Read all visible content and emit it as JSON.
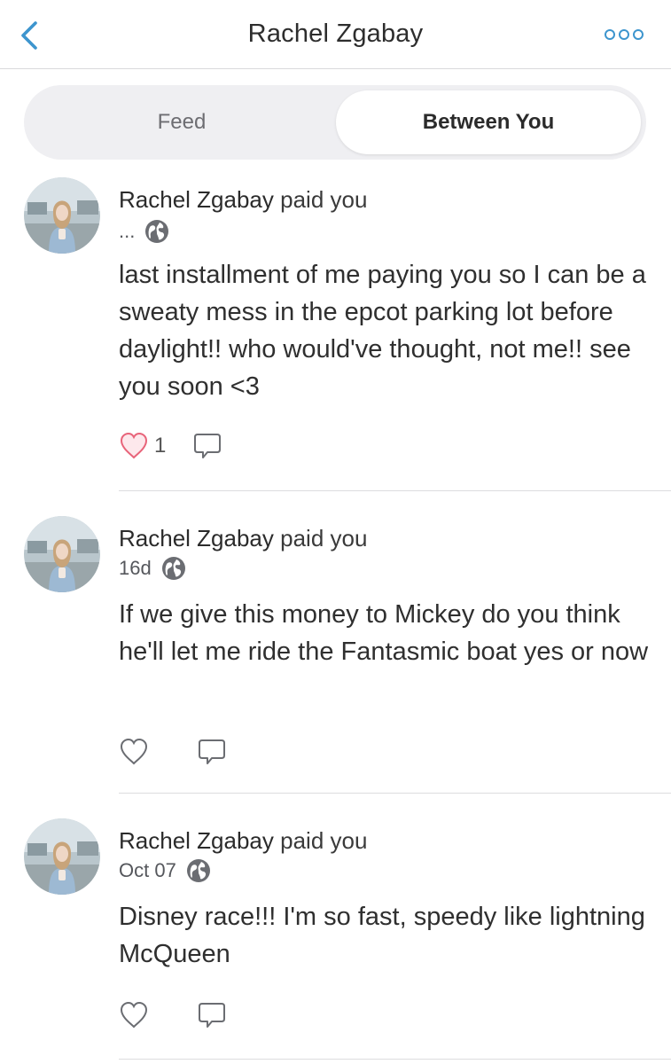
{
  "header": {
    "title": "Rachel Zgabay"
  },
  "tabs": [
    {
      "label": "Feed",
      "selected": false
    },
    {
      "label": "Between You",
      "selected": true
    }
  ],
  "stories": [
    {
      "name": "Rachel Zgabay",
      "action": "paid you",
      "time": "...",
      "note": "last installment of me paying you so I can be a sweaty mess in the epcot parking lot before daylight!! who would've thought, not me!! see you soon <3",
      "liked": true,
      "like_count": "1"
    },
    {
      "name": "Rachel Zgabay",
      "action": "paid you",
      "time": "16d",
      "note": "If we give this money to Mickey do you think he'll let me ride the Fantasmic boat yes or now",
      "liked": false,
      "like_count": ""
    },
    {
      "name": "Rachel Zgabay",
      "action": "paid you",
      "time": "Oct 07",
      "note": "Disney race!!! I'm so fast, speedy like lightning McQueen",
      "liked": false,
      "like_count": ""
    }
  ],
  "colors": {
    "accent": "#3d95ce",
    "like_active": "#e8647a",
    "icon_gray": "#6b6d72"
  }
}
